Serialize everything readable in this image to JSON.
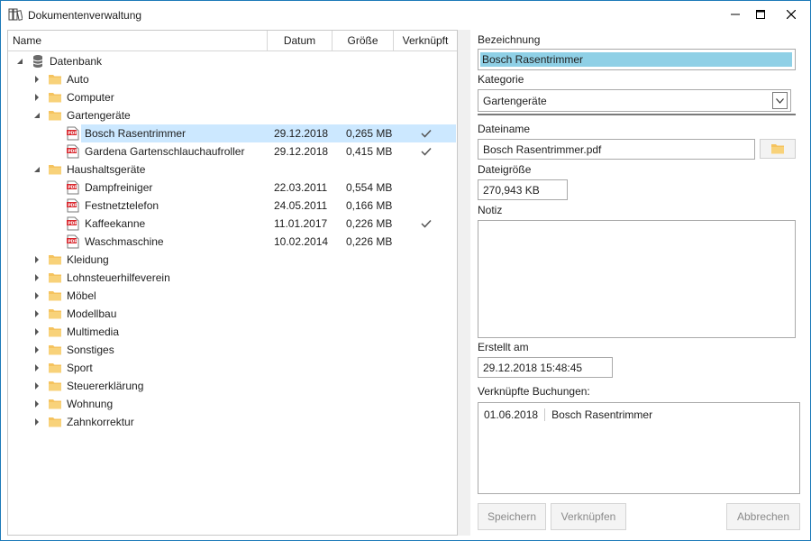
{
  "window": {
    "title": "Dokumentenverwaltung",
    "icons": {
      "app": "books-icon",
      "minimize": "minimize-icon",
      "maximize": "maximize-icon",
      "close": "close-icon"
    }
  },
  "tree": {
    "columns": {
      "name": "Name",
      "datum": "Datum",
      "groesse": "Größe",
      "verknuepft": "Verknüpft"
    },
    "root": "Datenbank",
    "items": [
      {
        "label": "Auto"
      },
      {
        "label": "Computer"
      },
      {
        "label": "Gartengeräte"
      },
      {
        "label": "Bosch Rasentrimmer",
        "datum": "29.12.2018",
        "groesse": "0,265 MB"
      },
      {
        "label": "Gardena Gartenschlauchaufroller",
        "datum": "29.12.2018",
        "groesse": "0,415 MB"
      },
      {
        "label": "Haushaltsgeräte"
      },
      {
        "label": "Dampfreiniger",
        "datum": "22.03.2011",
        "groesse": "0,554 MB"
      },
      {
        "label": "Festnetztelefon",
        "datum": "24.05.2011",
        "groesse": "0,166 MB"
      },
      {
        "label": "Kaffeekanne",
        "datum": "11.01.2017",
        "groesse": "0,226 MB"
      },
      {
        "label": "Waschmaschine",
        "datum": "10.02.2014",
        "groesse": "0,226 MB"
      },
      {
        "label": "Kleidung"
      },
      {
        "label": "Lohnsteuerhilfeverein"
      },
      {
        "label": "Möbel"
      },
      {
        "label": "Modellbau"
      },
      {
        "label": "Multimedia"
      },
      {
        "label": "Sonstiges"
      },
      {
        "label": "Sport"
      },
      {
        "label": "Steuererklärung"
      },
      {
        "label": "Wohnung"
      },
      {
        "label": "Zahnkorrektur"
      }
    ]
  },
  "detail": {
    "bezeichnung_label": "Bezeichnung",
    "bezeichnung_value": "Bosch Rasentrimmer",
    "kategorie_label": "Kategorie",
    "kategorie_value": "Gartengeräte",
    "dateiname_label": "Dateiname",
    "dateiname_value": "Bosch Rasentrimmer.pdf",
    "dateigroesse_label": "Dateigröße",
    "dateigroesse_value": "270,943 KB",
    "notiz_label": "Notiz",
    "notiz_value": "",
    "erstellt_label": "Erstellt am",
    "erstellt_value": "29.12.2018 15:48:45",
    "buchungen_label": "Verknüpfte Buchungen:",
    "buchungen": [
      {
        "datum": "01.06.2018",
        "text": "Bosch Rasentrimmer"
      }
    ],
    "buttons": {
      "speichern": "Speichern",
      "verknuepfen": "Verknüpfen",
      "abbrechen": "Abbrechen"
    }
  },
  "colors": {
    "selection": "#cce8ff",
    "text_selection": "#8fd0e6",
    "folder": "#f5c35f",
    "pdf": "#d9262c",
    "window_border": "#1d7ab8"
  }
}
